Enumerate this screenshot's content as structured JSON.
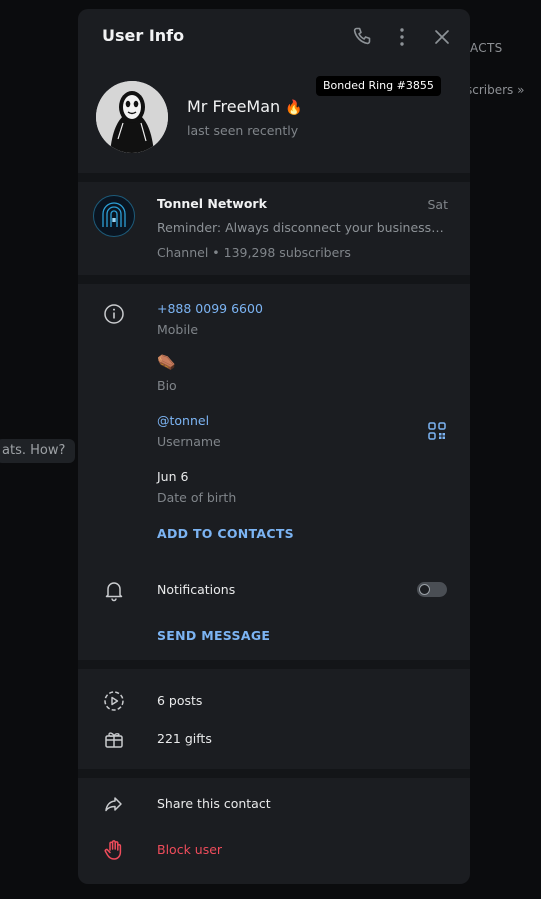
{
  "background": {
    "contacts_fragment": "ACTS",
    "subscribers_fragment": "scribers »",
    "chat_fragment": "ats. How?"
  },
  "header": {
    "title": "User Info",
    "icons": [
      "phone-icon",
      "more-vertical-icon",
      "close-icon"
    ]
  },
  "profile": {
    "name": "Mr FreeMan",
    "name_emoji": "🔥",
    "status": "last seen recently",
    "tooltip": "Bonded Ring #3855"
  },
  "channel": {
    "name": "Tonnel Network",
    "date": "Sat",
    "message": "Reminder: Always disconnect your business co...",
    "subtitle": "Channel • 139,298 subscribers"
  },
  "info": {
    "phone": "+888 0099 6600",
    "phone_label": "Mobile",
    "bio": "⚰️",
    "bio_label": "Bio",
    "username": "@tonnel",
    "username_label": "Username",
    "birthday": "Jun 6",
    "birthday_label": "Date of birth",
    "add_to_contacts": "ADD TO CONTACTS"
  },
  "notifications": {
    "label": "Notifications",
    "enabled": false,
    "send_message": "SEND MESSAGE"
  },
  "stats": {
    "posts": "6 posts",
    "gifts": "221 gifts"
  },
  "actions": {
    "share": "Share this contact",
    "block": "Block user"
  },
  "colors": {
    "panel": "#1b1d21",
    "accent": "#7cb4f3",
    "danger": "#ef4c5b"
  }
}
